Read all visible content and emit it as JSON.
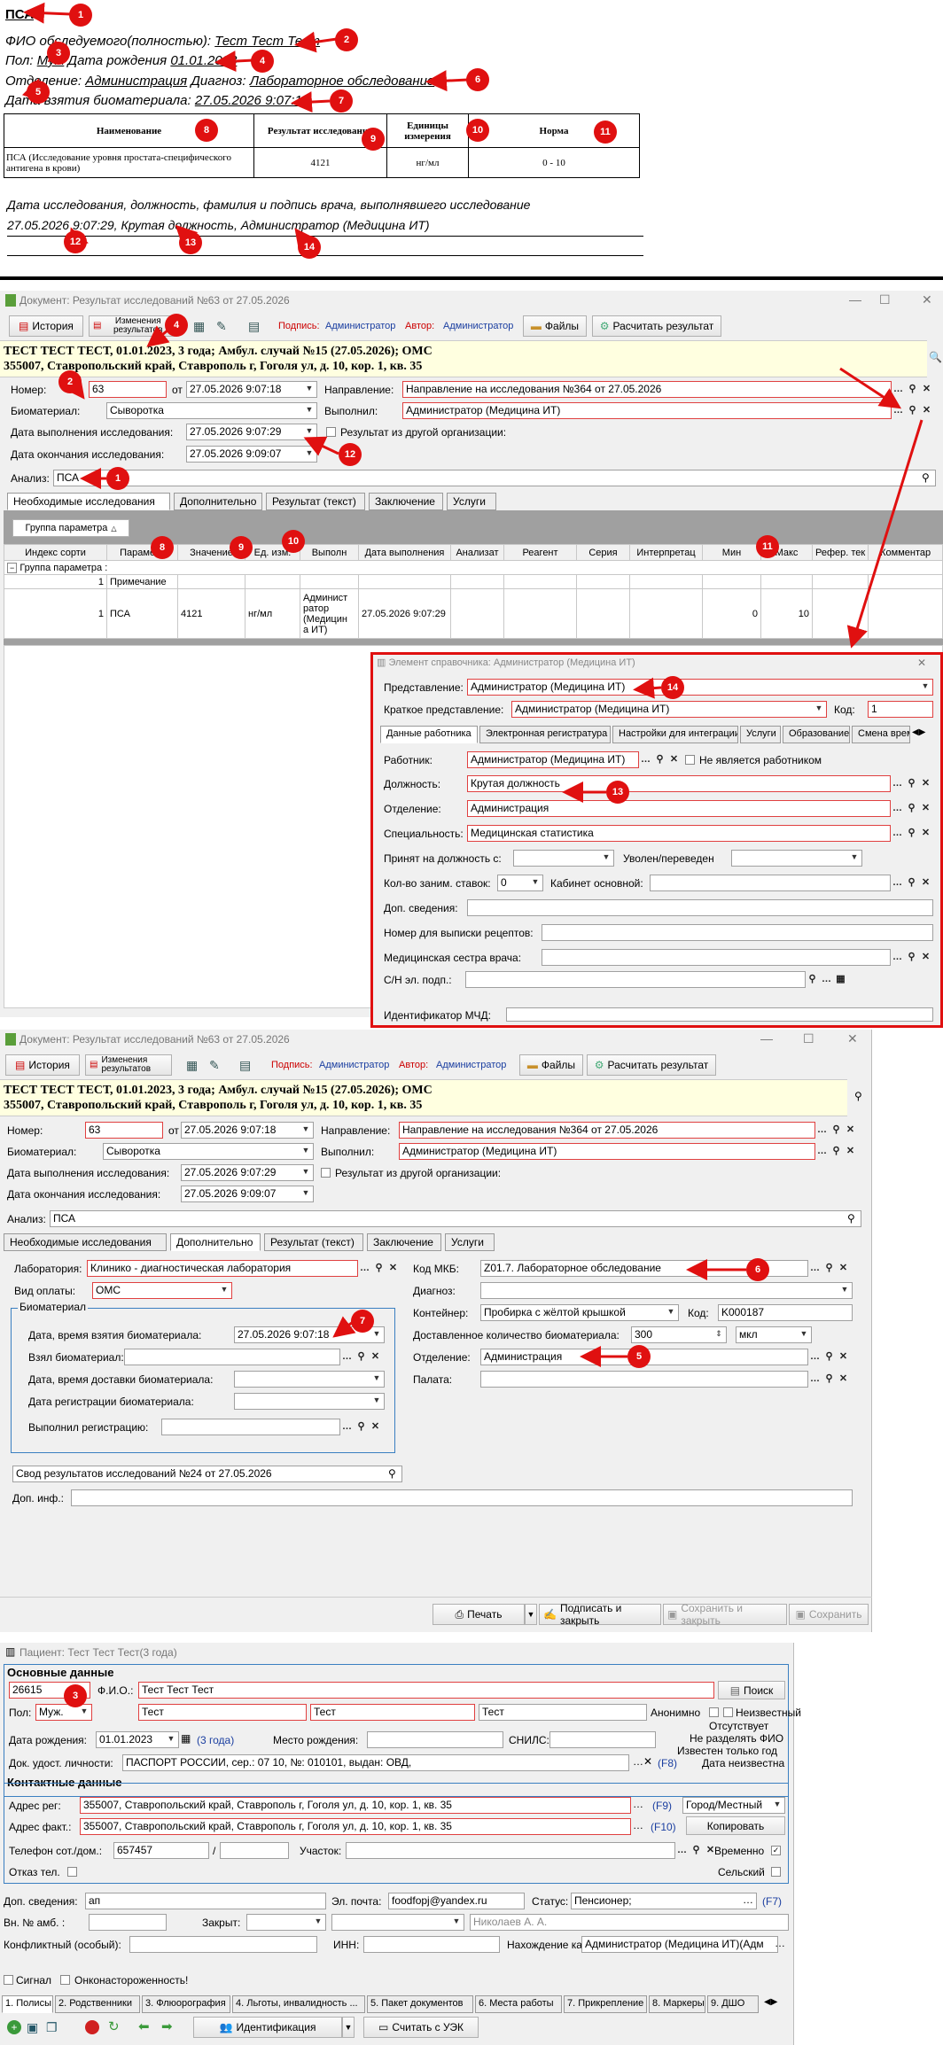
{
  "report": {
    "title": "ПСА",
    "fio_label": "ФИО обследуемого(полностью): ",
    "fio_value": "Тест Тест Тест",
    "sex_label": "Пол: ",
    "sex_value": "Муж",
    "dob_label": " Дата рождения ",
    "dob_value": "01.01.2023",
    "dept_label": "Отделение: ",
    "dept_value": "Администрация",
    "diag_label": " Диагноз: ",
    "diag_value": "Лабораторное обследование",
    "sample_label": "Дата взятия биоматериала: ",
    "sample_value": "27.05.2026 9:07:18",
    "table_headers": [
      "Наименование",
      "Результат исследования",
      "Единицы измерения",
      "Норма"
    ],
    "table_row": [
      "ПСА     (Исследование уровня простата-специфического антигена в крови)",
      "4121",
      "нг/мл",
      "0 - 10"
    ],
    "footer_label": "Дата исследования, должность, фамилия и подпись врача, выполнявшего исследование",
    "footer_value": "27.05.2026 9:07:29, Крутая должность, Администратор (Медицина ИТ)"
  },
  "badges": [
    "1",
    "2",
    "3",
    "4",
    "5",
    "6",
    "7",
    "8",
    "9",
    "10",
    "11",
    "12",
    "13",
    "14"
  ],
  "doc1": {
    "window_title": "Документ: Результат исследований №63 от 27.05.2026",
    "toolbar": {
      "history": "История",
      "changes": "Изменения результатов",
      "sign_label": "Подпись:",
      "sign_value": "Администратор",
      "author_label": "Автор:",
      "author_value": "Администратор",
      "files": "Файлы",
      "calc": "Расчитать результат"
    },
    "patient_line1": "ТЕСТ ТЕСТ ТЕСТ, 01.01.2023, 3 года; Амбул. случай №15 (27.05.2026); ОМС",
    "patient_line2": "355007, Ставропольский край, Ставрополь г, Гоголя ул, д. 10, кор. 1, кв. 35",
    "number_label": "Номер:",
    "number_value": "63",
    "from_label": "от",
    "date_value": "27.05.2026 9:07:18",
    "direction_label": "Направление:",
    "direction_value": "Направление на исследования №364 от 27.05.2026",
    "bio_label": "Биоматериал:",
    "bio_value": "Сыворотка",
    "performer_label": "Выполнил:",
    "performer_value": "Администратор (Медицина ИТ)",
    "exec_date_label": "Дата выполнения исследования:",
    "exec_date_value": "27.05.2026 9:07:29",
    "other_org_label": "Результат из другой организации:",
    "end_date_label": "Дата окончания исследования:",
    "end_date_value": "27.05.2026 9:09:07",
    "analysis_label": "Анализ:",
    "analysis_value": "ПСА",
    "tabs": [
      "Необходимые исследования",
      "Дополнительно",
      "Результат (текст)",
      "Заключение",
      "Услуги"
    ],
    "group_btn": "Группа параметра",
    "grid_headers": [
      "Индекс сорти",
      "Параметр",
      "Значение",
      "Ед. изм.",
      "Выполн",
      "Дата выполнения",
      "Анализат",
      "Реагент",
      "Серия",
      "Интерпретац",
      "Мин",
      "Макс",
      "Рефер. тек",
      "Комментар"
    ],
    "group_row": "Группа параметра :",
    "row1": {
      "idx": "1",
      "param": "Примечание"
    },
    "row2": {
      "idx": "1",
      "param": "ПСА",
      "value": "4121",
      "unit": "нг/мл",
      "performer": "Админист ратор (Медицин а ИТ)",
      "date": "27.05.2026 9:07:29",
      "min": "0",
      "max": "10"
    }
  },
  "dialog": {
    "title": "Элемент справочника: Администратор (Медицина ИТ)",
    "repr_label": "Представление:",
    "repr_value": "Администратор (Медицина ИТ)",
    "short_label": "Краткое представление:",
    "short_value": "Администратор (Медицина ИТ)",
    "code_label": "Код:",
    "code_value": "1",
    "tabs": [
      "Данные работника",
      "Электронная регистратура",
      "Настройки для интеграции",
      "Услуги",
      "Образование",
      "Смена врем"
    ],
    "worker_label": "Работник:",
    "worker_value": "Администратор (Медицина ИТ)",
    "not_worker": "Не является работником",
    "position_label": "Должность:",
    "position_value": "Крутая должность",
    "dept_label": "Отделение:",
    "dept_value": "Администрация",
    "spec_label": "Специальность:",
    "spec_value": "Медицинская статистика",
    "hired_label": "Принят на должность с:",
    "fired_label": "Уволен/переведен",
    "rates_label": "Кол-во заним. ставок:",
    "rates_value": "0",
    "cabinet_label": "Кабинет основной:",
    "extra_label": "Доп. сведения:",
    "recipe_label": "Номер для выписки рецептов:",
    "nurse_label": "Медицинская сестра врача:",
    "snils_label": "С/Н эл. подп.:",
    "mchd_label": "Идентификатор МЧД:"
  },
  "doc2": {
    "window_title": "Документ: Результат исследований №63 от 27.05.2026",
    "lab_label": "Лаборатория:",
    "lab_value": "Клинико - диагностическая лаборатория",
    "pay_label": "Вид оплаты:",
    "pay_value": "ОМС",
    "bio_group": "Биоматериал",
    "take_label": "Дата, время взятия биоматериала:",
    "take_value": "27.05.2026 9:07:18",
    "took_label": "Взял биоматериал:",
    "delivery_label": "Дата, время доставки биоматериала:",
    "reg_label": "Дата регистрации биоматериала:",
    "reg_by_label": "Выполнил регистрацию:",
    "mkb_label": "Код МКБ:",
    "mkb_value": "Z01.7. Лабораторное обследование",
    "diag_label": "Диагноз:",
    "container_label": "Контейнер:",
    "container_value": "Пробирка с жёлтой крышкой",
    "code_label": "Код:",
    "code_value": "K000187",
    "qty_label": "Доставленное количество биоматериала:",
    "qty_value": "300",
    "qty_unit": "мкл",
    "dept_label": "Отделение:",
    "dept_value": "Администрация",
    "ward_label": "Палата:",
    "summary_value": "Свод результатов исследований №24 от 27.05.2026",
    "extra_label": "Доп. инф.:",
    "buttons": [
      "Печать",
      "Подписать и закрыть",
      "Сохранить и закрыть",
      "Сохранить"
    ]
  },
  "patient": {
    "window_title": "Пациент: Тест Тест Тест(3 года)",
    "main_section": "Основные данные",
    "id_value": "26615",
    "fio_label": "Ф.И.О.:",
    "fio_value": "Тест Тест Тест",
    "search_btn": "Поиск",
    "sex_label": "Пол:",
    "sex_value": "Муж.",
    "last": "Тест",
    "first": "Тест",
    "middle": "Тест",
    "anon": "Анонимно",
    "unknown": "Неизвестный",
    "absent": "Отсутствует",
    "no_split": "Не разделять ФИО",
    "year_only": "Известен только год",
    "date_unknown": "Дата неизвестна",
    "dob_label": "Дата рождения:",
    "dob_value": "01.01.2023",
    "age": "(3 года)",
    "pob_label": "Место рождения:",
    "snils_label": "СНИЛС:",
    "doc_label": "Док. удост. личности:",
    "doc_value": "ПАСПОРТ РОССИИ, сер.: 07 10, №: 010101, выдан: ОВД,",
    "f8": "(F8)",
    "contact_section": "Контактные данные",
    "addr_reg_label": "Адрес рег:",
    "addr_value": "355007, Ставропольский край, Ставрополь г, Гоголя ул, д. 10, кор. 1, кв. 35",
    "f9": "(F9)",
    "city": "Город/Местный",
    "addr_fact_label": "Адрес факт.:",
    "f10": "(F10)",
    "copy_btn": "Копировать",
    "phone_label": "Телефон сот./дом.:",
    "phone_value": "657457",
    "area_label": "Участок:",
    "temp": "Временно",
    "refuse_label": "Отказ тел.",
    "rural": "Сельский",
    "extra_label": "Доп. сведения:",
    "extra_value": "ап",
    "email_label": "Эл. почта:",
    "email_value": "foodfopj@yandex.ru",
    "status_label": "Статус:",
    "status_value": "Пенсионер;",
    "f7": "(F7)",
    "amb_label": "Вн. № амб. :",
    "closed_label": "Закрыт:",
    "doctor_value": "Николаев А. А.",
    "conflict_label": "Конфликтный (особый):",
    "inn_label": "ИНН:",
    "card_label": "Нахождение карты:",
    "card_value": "Администратор (Медицина ИТ)(Адм",
    "signal": "Сигнал",
    "oncology": "Онконастороженность!",
    "tabs": [
      "1. Полисы",
      "2. Родственники",
      "3. Флюорография",
      "4. Льготы, инвалидность ...",
      "5. Пакет документов",
      "6. Места работы",
      "7. Прикрепление",
      "8. Маркеры",
      "9. ДШО"
    ],
    "ident_btn": "Идентификация",
    "uek_btn": "Считать с УЭК"
  }
}
